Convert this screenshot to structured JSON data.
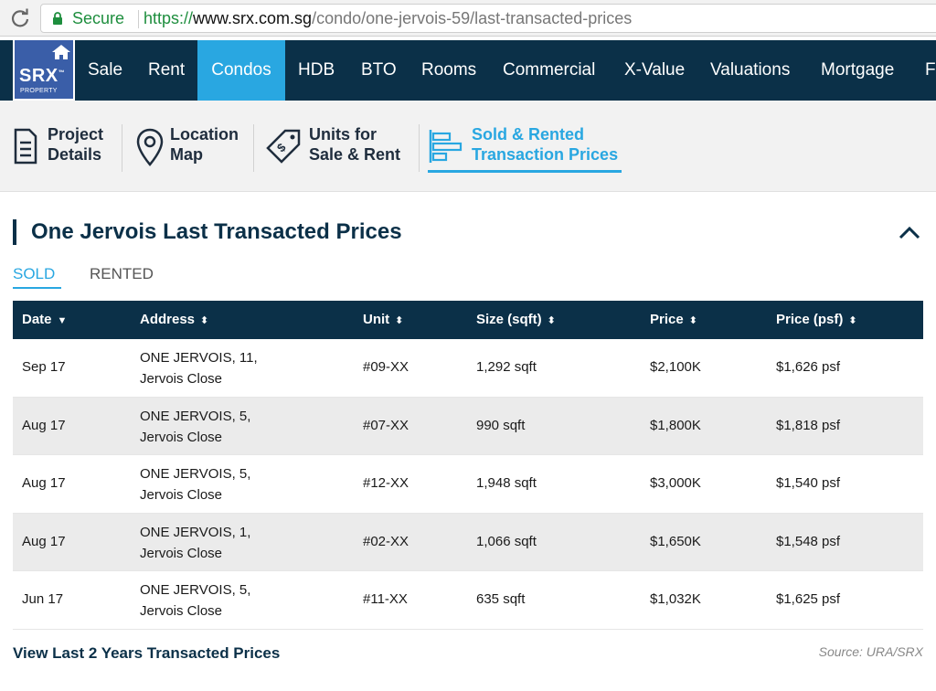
{
  "browser": {
    "secure_label": "Secure",
    "url_proto": "https://",
    "url_host": "www.srx.com.sg",
    "url_path": "/condo/one-jervois-59/last-transacted-prices"
  },
  "logo": {
    "name": "SRX",
    "sub": "PROPERTY",
    "trademark": "™"
  },
  "nav": {
    "items": [
      {
        "label": "Sale",
        "active": false
      },
      {
        "label": "Rent",
        "active": false
      },
      {
        "label": "Condos",
        "active": true
      },
      {
        "label": "HDB",
        "active": false
      },
      {
        "label": "BTO",
        "active": false
      },
      {
        "label": "Rooms",
        "active": false
      },
      {
        "label": "Commercial",
        "active": false
      },
      {
        "label": "X-Value",
        "active": false
      },
      {
        "label": "Valuations",
        "active": false
      },
      {
        "label": "Mortgage",
        "active": false
      },
      {
        "label": "Fi",
        "active": false
      }
    ]
  },
  "subnav": {
    "tabs": [
      {
        "line1": "Project",
        "line2": "Details",
        "icon": "document-icon",
        "active": false
      },
      {
        "line1": "Location",
        "line2": "Map",
        "icon": "map-pin-icon",
        "active": false
      },
      {
        "line1": "Units for",
        "line2": "Sale & Rent",
        "icon": "price-tag-icon",
        "active": false
      },
      {
        "line1": "Sold & Rented",
        "line2": "Transaction Prices",
        "icon": "bar-list-icon",
        "active": true
      }
    ]
  },
  "section": {
    "title": "One Jervois Last Transacted Prices",
    "tabs": {
      "sold": "SOLD",
      "rented": "RENTED"
    },
    "active_tab": "SOLD"
  },
  "table": {
    "headers": {
      "date": "Date",
      "address": "Address",
      "unit": "Unit",
      "size": "Size (sqft)",
      "price": "Price",
      "psf": "Price (psf)"
    },
    "sort": {
      "date": "▼",
      "address": "⬍",
      "unit": "⬍",
      "size": "⬍",
      "price": "⬍",
      "psf": "⬍"
    },
    "rows": [
      {
        "date": "Sep 17",
        "addr1": "ONE JERVOIS, 11,",
        "addr2": "Jervois Close",
        "unit": "#09-XX",
        "size": "1,292 sqft",
        "price": "$2,100K",
        "psf": "$1,626 psf"
      },
      {
        "date": "Aug 17",
        "addr1": "ONE JERVOIS, 5,",
        "addr2": "Jervois Close",
        "unit": "#07-XX",
        "size": "990 sqft",
        "price": "$1,800K",
        "psf": "$1,818 psf"
      },
      {
        "date": "Aug 17",
        "addr1": "ONE JERVOIS, 5,",
        "addr2": "Jervois Close",
        "unit": "#12-XX",
        "size": "1,948 sqft",
        "price": "$3,000K",
        "psf": "$1,540 psf"
      },
      {
        "date": "Aug 17",
        "addr1": "ONE JERVOIS, 1,",
        "addr2": "Jervois Close",
        "unit": "#02-XX",
        "size": "1,066 sqft",
        "price": "$1,650K",
        "psf": "$1,548 psf"
      },
      {
        "date": "Jun 17",
        "addr1": "ONE JERVOIS, 5,",
        "addr2": "Jervois Close",
        "unit": "#11-XX",
        "size": "635 sqft",
        "price": "$1,032K",
        "psf": "$1,625 psf"
      }
    ]
  },
  "footer": {
    "link": "View Last 2 Years Transacted Prices",
    "source": "Source: URA/SRX"
  },
  "colors": {
    "navy": "#0b3048",
    "accent": "#29a7e1",
    "logo_blue": "#3a5ea8",
    "secure_green": "#1e8e3e"
  }
}
